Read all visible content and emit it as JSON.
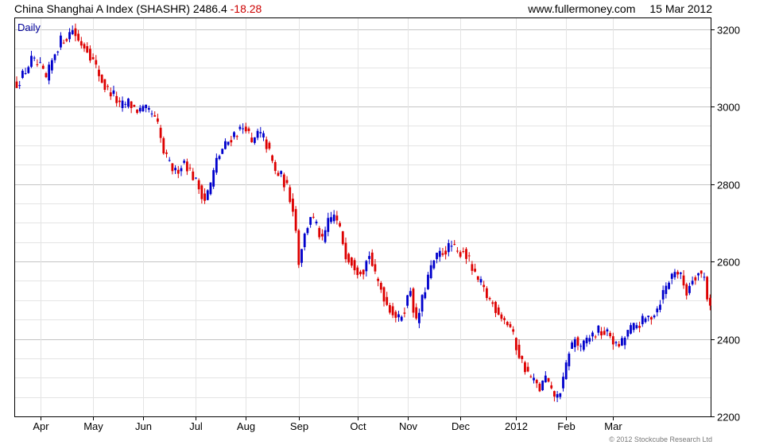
{
  "header": {
    "index_name": "China Shanghai A Index (SHASHR)",
    "last_value": "2486.4",
    "change": "-18.28",
    "site": "www.fullermoney.com",
    "date": "15 Mar 2012"
  },
  "footer": {
    "copyright": "© 2012 Stockcube Research Ltd"
  },
  "colors": {
    "up": "#0000cc",
    "down": "#dd0000",
    "grid": "#cccccc",
    "frame": "#000000",
    "label": "#000099"
  },
  "chart_data": {
    "type": "candlestick",
    "title": "China Shanghai A Index (SHASHR)",
    "period_label": "Daily",
    "xlabel": "",
    "ylabel": "",
    "y_axis_position": "right",
    "ylim": [
      2200,
      3230
    ],
    "y_ticks": [
      2200,
      2400,
      2600,
      2800,
      3000,
      3200
    ],
    "x_ticks": [
      "Apr",
      "May",
      "Jun",
      "Jul",
      "Aug",
      "Sep",
      "Oct",
      "Nov",
      "Dec",
      "2012",
      "Feb",
      "Mar"
    ],
    "grid": true,
    "close_path": [
      [
        0,
        3060
      ],
      [
        2,
        3080
      ],
      [
        5,
        3120
      ],
      [
        8,
        3100
      ],
      [
        10,
        3070
      ],
      [
        13,
        3140
      ],
      [
        15,
        3170
      ],
      [
        17,
        3180
      ],
      [
        19,
        3200
      ],
      [
        21,
        3170
      ],
      [
        24,
        3150
      ],
      [
        27,
        3100
      ],
      [
        30,
        3050
      ],
      [
        33,
        3030
      ],
      [
        35,
        3000
      ],
      [
        38,
        3010
      ],
      [
        41,
        2990
      ],
      [
        44,
        2990
      ],
      [
        46,
        2980
      ],
      [
        48,
        2950
      ],
      [
        50,
        2880
      ],
      [
        52,
        2850
      ],
      [
        54,
        2830
      ],
      [
        57,
        2860
      ],
      [
        60,
        2820
      ],
      [
        62,
        2790
      ],
      [
        64,
        2760
      ],
      [
        66,
        2800
      ],
      [
        68,
        2860
      ],
      [
        70,
        2890
      ],
      [
        72,
        2910
      ],
      [
        74,
        2930
      ],
      [
        76,
        2940
      ],
      [
        78,
        2950
      ],
      [
        80,
        2900
      ],
      [
        82,
        2930
      ],
      [
        84,
        2920
      ],
      [
        86,
        2880
      ],
      [
        88,
        2830
      ],
      [
        90,
        2820
      ],
      [
        92,
        2790
      ],
      [
        94,
        2740
      ],
      [
        95,
        2680
      ],
      [
        96,
        2600
      ],
      [
        97,
        2640
      ],
      [
        100,
        2720
      ],
      [
        102,
        2690
      ],
      [
        104,
        2650
      ],
      [
        106,
        2700
      ],
      [
        108,
        2720
      ],
      [
        110,
        2680
      ],
      [
        112,
        2620
      ],
      [
        114,
        2600
      ],
      [
        116,
        2580
      ],
      [
        118,
        2580
      ],
      [
        120,
        2620
      ],
      [
        121,
        2590
      ],
      [
        122,
        2560
      ],
      [
        124,
        2530
      ],
      [
        126,
        2490
      ],
      [
        128,
        2470
      ],
      [
        130,
        2450
      ],
      [
        132,
        2480
      ],
      [
        134,
        2530
      ],
      [
        135,
        2480
      ],
      [
        136,
        2440
      ],
      [
        138,
        2500
      ],
      [
        140,
        2560
      ],
      [
        142,
        2600
      ],
      [
        144,
        2620
      ],
      [
        146,
        2630
      ],
      [
        148,
        2640
      ],
      [
        150,
        2620
      ],
      [
        152,
        2630
      ],
      [
        154,
        2600
      ],
      [
        156,
        2560
      ],
      [
        158,
        2540
      ],
      [
        160,
        2510
      ],
      [
        162,
        2490
      ],
      [
        164,
        2470
      ],
      [
        166,
        2450
      ],
      [
        168,
        2430
      ],
      [
        170,
        2380
      ],
      [
        172,
        2340
      ],
      [
        174,
        2310
      ],
      [
        176,
        2290
      ],
      [
        178,
        2270
      ],
      [
        180,
        2300
      ],
      [
        182,
        2260
      ],
      [
        184,
        2250
      ],
      [
        186,
        2290
      ],
      [
        188,
        2370
      ],
      [
        190,
        2400
      ],
      [
        192,
        2370
      ],
      [
        194,
        2400
      ],
      [
        196,
        2410
      ],
      [
        198,
        2420
      ],
      [
        202,
        2410
      ],
      [
        204,
        2380
      ],
      [
        206,
        2390
      ],
      [
        208,
        2420
      ],
      [
        210,
        2430
      ],
      [
        212,
        2440
      ],
      [
        214,
        2450
      ],
      [
        216,
        2460
      ],
      [
        218,
        2480
      ],
      [
        220,
        2520
      ],
      [
        222,
        2550
      ],
      [
        224,
        2580
      ],
      [
        226,
        2560
      ],
      [
        228,
        2520
      ],
      [
        230,
        2560
      ],
      [
        232,
        2570
      ],
      [
        234,
        2560
      ],
      [
        235,
        2510
      ],
      [
        236,
        2486
      ]
    ]
  }
}
